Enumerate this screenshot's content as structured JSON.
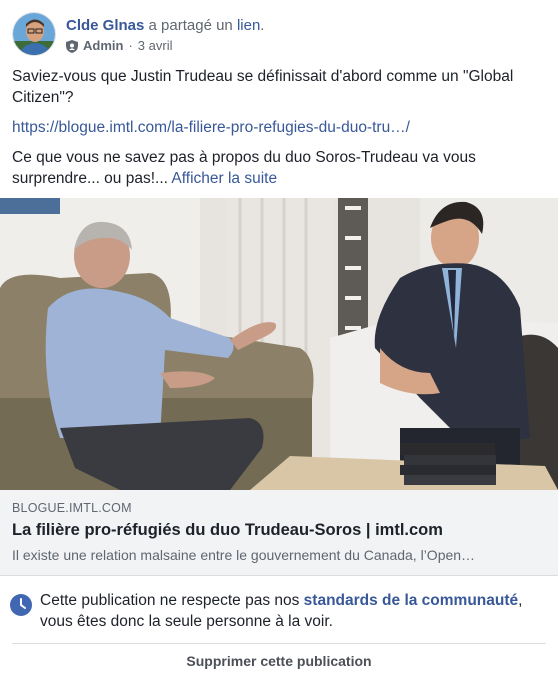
{
  "post": {
    "author": "Clde Glnas",
    "shared_text": " a partagé un ",
    "shared_link": "lien",
    "shared_end": ".",
    "role": "Admin",
    "separator": "·",
    "date": "3 avril",
    "paragraph1": "Saviez-vous que Justin Trudeau se définissait d'abord comme un \"Global Citizen\"?",
    "url": "https://blogue.imtl.com/la-filiere-pro-refugies-du-duo-tru…/",
    "paragraph2": "Ce que vous ne savez pas à propos du duo Soros-Trudeau va vous surprendre... ou pas!... ",
    "see_more": "Afficher la suite"
  },
  "preview": {
    "domain": "BLOGUE.IMTL.COM",
    "title": "La filière pro-réfugiés du duo Trudeau-Soros | imtl.com",
    "description": "Il existe une relation malsaine entre le gouvernement du Canada, l’Open…"
  },
  "notice": {
    "text_before": "Cette publication ne respecte pas nos ",
    "link": "standards de la communauté",
    "text_after": ", vous êtes donc la seule personne à la voir.",
    "delete_label": "Supprimer cette publication"
  },
  "icons": {
    "avatar": "profile-photo",
    "admin": "shield-icon",
    "notice": "clock-icon"
  },
  "colors": {
    "link": "#385898",
    "meta": "#606770",
    "text": "#1d2129",
    "preview_bg": "#f2f3f5",
    "clock": "#4267b2"
  }
}
